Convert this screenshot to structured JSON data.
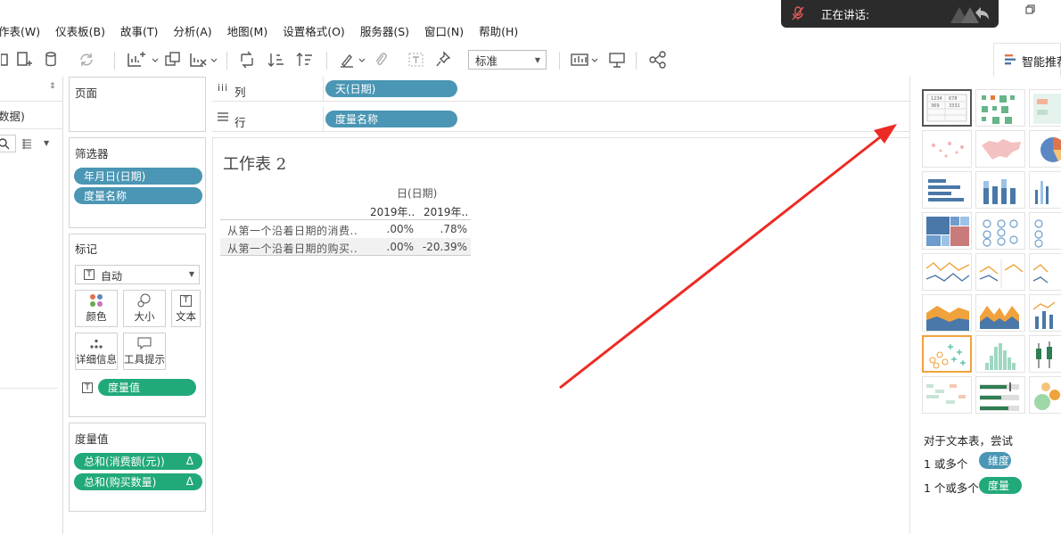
{
  "menu": [
    "作表(W)",
    "仪表板(B)",
    "故事(T)",
    "分析(A)",
    "地图(M)",
    "设置格式(O)",
    "服务器(S)",
    "窗口(N)",
    "帮助(H)"
  ],
  "banner": {
    "text": "正在讲话:"
  },
  "toolbar": {
    "fit_select": "标准"
  },
  "smart_tab": {
    "label": "智能推荐"
  },
  "data_pane": {
    "source_label": "数据)"
  },
  "pages": {
    "title": "页面"
  },
  "filters": {
    "title": "筛选器",
    "items": [
      "年月日(日期)",
      "度量名称"
    ]
  },
  "marks": {
    "title": "标记",
    "type_select": "自动",
    "buttons": [
      "颜色",
      "大小",
      "文本",
      "详细信息",
      "工具提示"
    ],
    "pill": "度量值"
  },
  "measure_values": {
    "title": "度量值",
    "items": [
      "总和(消费额(元))",
      "总和(购买数量)"
    ],
    "delta_glyph": "Δ"
  },
  "shelves": {
    "columns_label": "列",
    "columns_pill": "天(日期)",
    "rows_label": "行",
    "rows_pill": "度量名称"
  },
  "sheet": {
    "title": "工作表 2",
    "header_group": "日(日期)",
    "col_headers": [
      "2019年..",
      "2019年.."
    ],
    "rows": [
      {
        "label": "从第一个沿着日期的消费..",
        "v1": ".00%",
        "v2": ".78%"
      },
      {
        "label": "从第一个沿着日期的购买..",
        "v1": ".00%",
        "v2": "-20.39%"
      }
    ]
  },
  "smart_hint": {
    "line1": "对于文本表，尝试",
    "line2_prefix": "1 或多个",
    "line2_pill": "维度",
    "line3_prefix": "1 个或多个",
    "line3_pill": "度量"
  },
  "colors": {
    "dimension": "#4a96b4",
    "measure": "#22a979",
    "arrow": "#ee2a24",
    "orange": "#f0a23c"
  }
}
